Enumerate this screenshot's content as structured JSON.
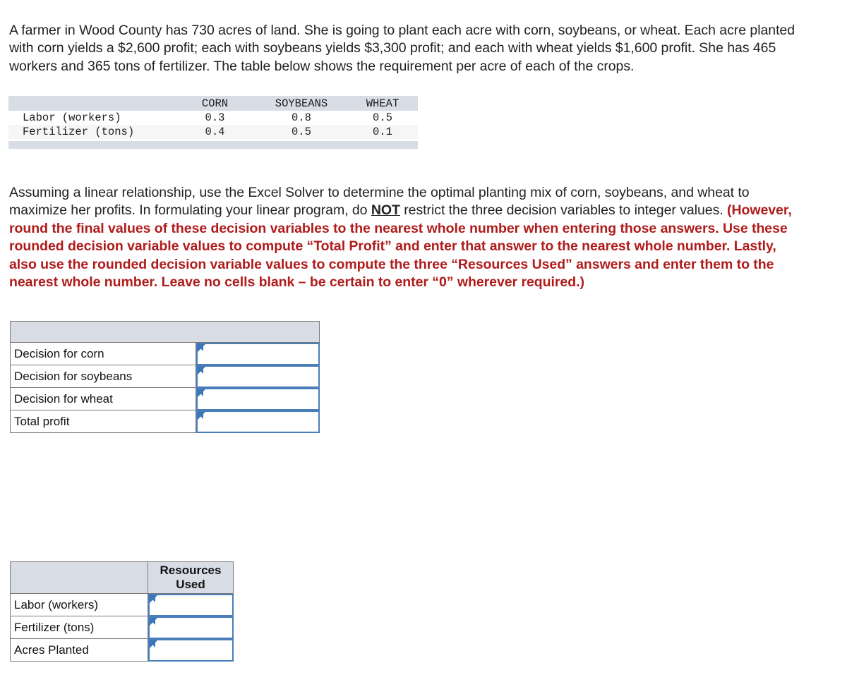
{
  "problem": {
    "intro": "A farmer in Wood County has 730 acres of land. She is going to plant each acre with corn, soybeans, or wheat. Each acre planted with corn yields a $2,600 profit; each with soybeans yields $3,300 profit; and each with wheat yields $1,600 profit. She has 465 workers and 365 tons of fertilizer. The table below shows the requirement per acre of each of the crops.",
    "instructions_part1": "Assuming a linear relationship, use the Excel Solver to determine the optimal planting mix of corn, soybeans, and wheat to maximize her profits.  In formulating your linear program, do ",
    "instructions_not": "NOT",
    "instructions_part2": " restrict the three decision variables to integer values. ",
    "instructions_red": "(However, round the final values of these decision variables to the nearest whole number when entering those answers.  Use these rounded decision variable values to compute “Total Profit” and enter that answer to the nearest whole number.  Lastly, also use the rounded decision variable values to compute the three “Resources Used” answers and enter them to the nearest whole number.  Leave no cells blank – be certain to enter “0” wherever required.)"
  },
  "requirements_table": {
    "headers": [
      "",
      "CORN",
      "SOYBEANS",
      "WHEAT"
    ],
    "rows": [
      {
        "label": "Labor (workers)",
        "corn": "0.3",
        "soybeans": "0.8",
        "wheat": "0.5"
      },
      {
        "label": "Fertilizer (tons)",
        "corn": "0.4",
        "soybeans": "0.5",
        "wheat": "0.1"
      }
    ]
  },
  "decision_table": {
    "header_label": "",
    "header_value": "",
    "rows": [
      {
        "label": "Decision for corn",
        "value": "",
        "placeholder": ""
      },
      {
        "label": "Decision for soybeans",
        "value": "",
        "placeholder": ""
      },
      {
        "label": "Decision for wheat",
        "value": "",
        "placeholder": ""
      },
      {
        "label": "Total profit",
        "value": "",
        "placeholder": ""
      }
    ]
  },
  "resources_table": {
    "header_label": "",
    "header_value": "Resources\nUsed",
    "header_value_line1": "Resources",
    "header_value_line2": "Used",
    "rows": [
      {
        "label": "Labor (workers)",
        "value": "",
        "placeholder": ""
      },
      {
        "label": "Fertilizer (tons)",
        "value": "",
        "placeholder": ""
      },
      {
        "label": "Acres Planted",
        "value": "",
        "placeholder": ""
      }
    ]
  },
  "colors": {
    "header_fill": "#d7dce5",
    "input_border": "#4a7ebb",
    "red_note": "#b01b1b",
    "cell_border": "#7a7a7a",
    "zebra_row": "#f6f6f6"
  }
}
